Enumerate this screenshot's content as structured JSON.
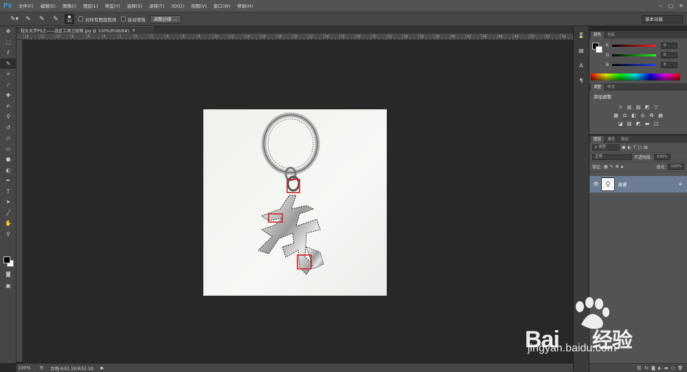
{
  "app": {
    "logo": "Ps"
  },
  "menu": [
    "文件(F)",
    "编辑(E)",
    "图像(I)",
    "图层(L)",
    "类型(Y)",
    "选择(S)",
    "滤镜(T)",
    "3D(D)",
    "视图(V)",
    "窗口(W)",
    "帮助(H)"
  ],
  "options": {
    "brush_size": "10",
    "sample_all_layers": "对所有图层取样",
    "auto_enhance": "自动增强",
    "refine_edge_button": "调整边缘 ...",
    "workspace": "基本功能"
  },
  "document": {
    "tab_title": "程太太学PS之——选区工具之抠图.jpg @ 100%(RGB/8#)",
    "zoom": "100%",
    "doc_size": "文档:632.1K/632.1K",
    "ruler_marks": [
      "14",
      "12",
      "10",
      "8",
      "6",
      "4",
      "2",
      "0",
      "2",
      "4",
      "6",
      "8",
      "10",
      "12",
      "14",
      "16",
      "18",
      "20",
      "22",
      "24",
      "26",
      "28",
      "30",
      "32",
      "34",
      "36",
      "38",
      "40",
      "42",
      "44",
      "46",
      "48",
      "50",
      "52",
      "54"
    ]
  },
  "panels": {
    "color": {
      "tabs": [
        "颜色",
        "色板"
      ],
      "channels": [
        {
          "label": "R",
          "value": "0",
          "color": "#e23b3b"
        },
        {
          "label": "G",
          "value": "0",
          "color": "#3bb53b"
        },
        {
          "label": "B",
          "value": "0",
          "color": "#3b52e2"
        }
      ]
    },
    "adjustments": {
      "tabs": [
        "调整",
        "样式"
      ],
      "title": "添加调整"
    },
    "layers": {
      "tabs": [
        "图层",
        "通道",
        "路径"
      ],
      "filter_type": "ρ 类型",
      "blend_mode": "正常",
      "opacity_label": "不透明度:",
      "opacity_value": "100%",
      "lock_label": "锁定:",
      "fill_label": "填充:",
      "fill_value": "100%",
      "layer_name": "背景"
    }
  },
  "watermark": {
    "brand": "Bai",
    "brand_suffix": "经验",
    "url": "jingyan.baidu.com"
  }
}
